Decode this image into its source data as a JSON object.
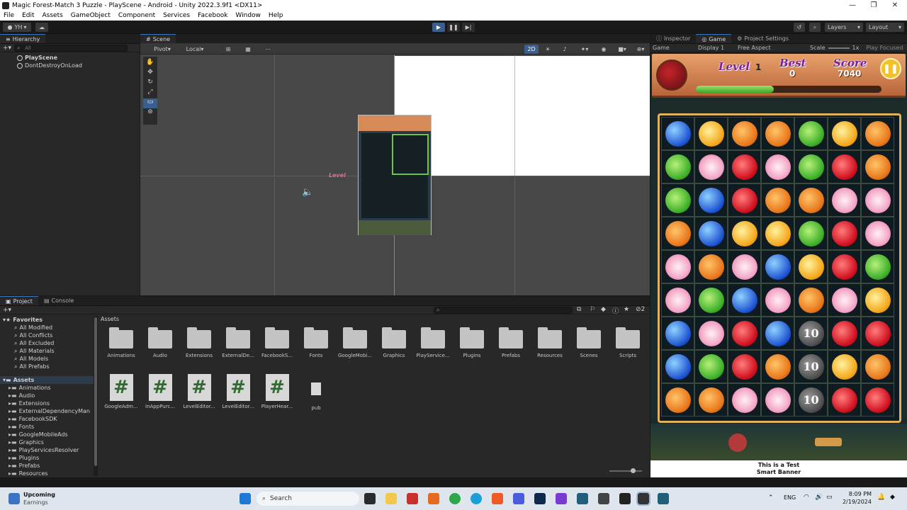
{
  "window": {
    "title": "Magic Forest-Match 3 Puzzle - PlayScene - Android - Unity 2022.3.9f1 <DX11>",
    "controls": [
      "—",
      "❐",
      "✕"
    ]
  },
  "menu": [
    "File",
    "Edit",
    "Assets",
    "GameObject",
    "Component",
    "Services",
    "Facebook",
    "Window",
    "Help"
  ],
  "toolbar": {
    "account": "YH",
    "layers": "Layers",
    "layout": "Layout"
  },
  "hierarchy": {
    "tab": "Hierarchy",
    "search_placeholder": "All",
    "items": [
      "PlayScene",
      "DontDestroyOnLoad"
    ]
  },
  "scene": {
    "tab": "Scene",
    "pivot": "Pivot",
    "local": "Local",
    "mode_2d": "2D",
    "level_label": "Level"
  },
  "game": {
    "tabs": [
      "Inspector",
      "Game",
      "Project Settings"
    ],
    "display_mode": "Game",
    "display": "Display 1",
    "aspect": "Free Aspect",
    "scale_label": "Scale",
    "scale_value": "1x",
    "play_focused": "Play Focused",
    "hud": {
      "level_label": "Level",
      "level_value": "1",
      "best_label": "Best",
      "best_value": "0",
      "score_label": "Score",
      "score_value": "7040",
      "progress": 0.42
    },
    "board": [
      [
        "blue",
        "orange-drop",
        "carrot",
        "carrot",
        "leaf",
        "orange-drop",
        "carrot"
      ],
      [
        "leaf",
        "flower",
        "apple",
        "flower",
        "leaf",
        "apple",
        "carrot"
      ],
      [
        "leaf",
        "blue",
        "apple",
        "carrot",
        "carrot",
        "flower",
        "flower"
      ],
      [
        "carrot",
        "blue",
        "orange-drop",
        "orange-drop",
        "leaf",
        "apple",
        "flower"
      ],
      [
        "flower",
        "carrot",
        "flower",
        "blue",
        "orange-drop",
        "apple",
        "leaf"
      ],
      [
        "flower",
        "leaf",
        "blue",
        "flower",
        "carrot",
        "flower",
        "orange-drop"
      ],
      [
        "blue",
        "flower",
        "apple",
        "blue",
        "bubble",
        "apple",
        "apple"
      ],
      [
        "blue",
        "leaf",
        "apple",
        "carrot",
        "bubble",
        "orange-drop",
        "carrot"
      ],
      [
        "carrot",
        "carrot",
        "flower",
        "flower",
        "bubble",
        "apple",
        "apple"
      ]
    ],
    "bubble_count": "10",
    "banner": [
      "This is a Test",
      "Smart Banner"
    ]
  },
  "project": {
    "tabs": [
      "Project",
      "Console"
    ],
    "favorites_label": "Favorites",
    "favorites": [
      "All Modified",
      "All Conflicts",
      "All Excluded",
      "All Materials",
      "All Models",
      "All Prefabs"
    ],
    "assets_label": "Assets",
    "tree": [
      "Animations",
      "Audio",
      "Extensions",
      "ExternalDependencyMan",
      "FacebookSDK",
      "Fonts",
      "GoogleMobileAds",
      "Graphics",
      "PlayServicesResolver",
      "Plugins",
      "Prefabs",
      "Resources"
    ],
    "breadcrumb": "Assets",
    "folders": [
      "Animations",
      "Audio",
      "Extensions",
      "ExternalDe...",
      "FacebookS...",
      "Fonts",
      "GoogleMobi...",
      "Graphics",
      "PlayService...",
      "Plugins",
      "Prefabs",
      "Resources",
      "Scenes",
      "Scripts"
    ],
    "scripts": [
      "GoogleAdm...",
      "InAppPurc...",
      "LevelEditor...",
      "LevelEditor...",
      "PlayerHear..."
    ],
    "files": [
      "pub"
    ],
    "hidden_count": "2"
  },
  "taskbar": {
    "weather_title": "Upcoming",
    "weather_sub": "Earnings",
    "search": "Search",
    "lang": "ENG",
    "time": "8:09 PM",
    "date": "2/19/2024"
  },
  "colors": {
    "accent": "#3a79bb",
    "hud_label": "#7b1fa2",
    "board_border": "#e0b25d"
  }
}
